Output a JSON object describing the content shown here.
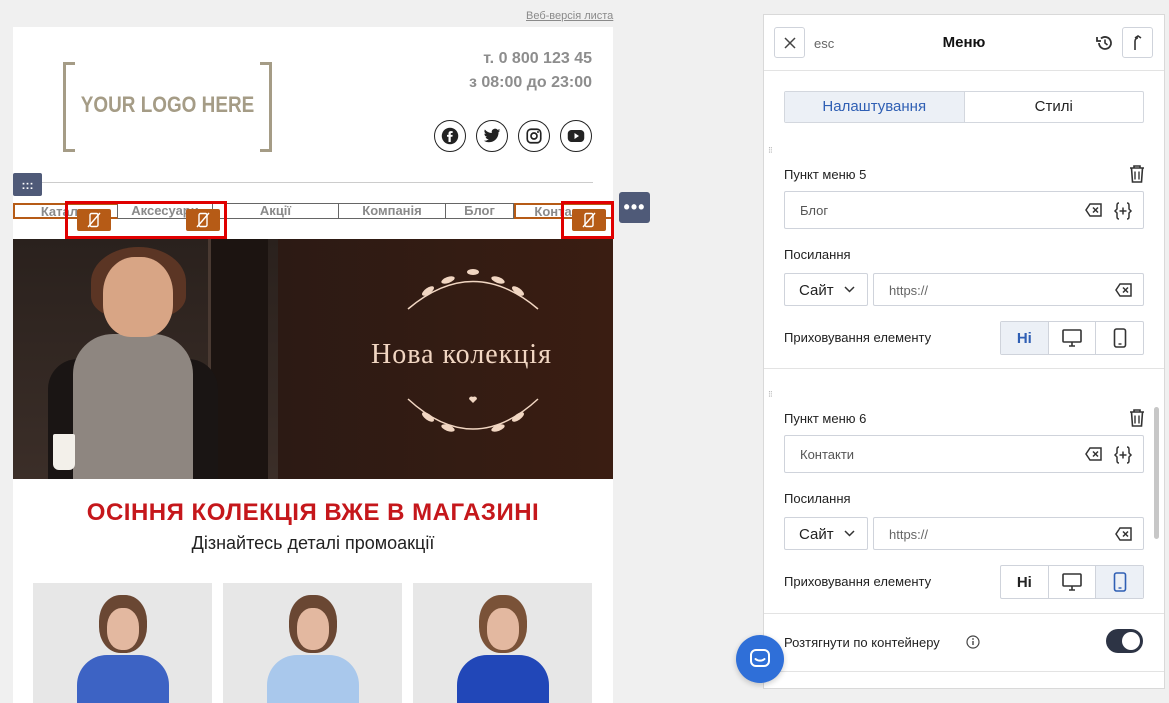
{
  "email": {
    "web_version_link": "Веб-версія листа",
    "logo_text": "YOUR LOGO HERE",
    "phone": "т. 0 800 123 45",
    "hours": "з 08:00 до 23:00",
    "socials": [
      "facebook-icon",
      "twitter-icon",
      "instagram-icon",
      "youtube-icon"
    ],
    "menu_items": [
      "Каталог",
      "Аксесуари",
      "Акції",
      "Компанія",
      "Блог",
      "Контакти"
    ],
    "hero_title": "Нова колекція",
    "headline": "ОСІННЯ КОЛЕКЦІЯ ВЖЕ В МАГАЗИНІ",
    "subheadline": "Дізнайтесь деталі промоакції",
    "colors": {
      "headline": "#c5171b",
      "accent": "#b65b16",
      "coat": "#3d63c4"
    }
  },
  "panel": {
    "close_hint": "esc",
    "title": "Меню",
    "tabs": [
      "Налаштування",
      "Стилі"
    ],
    "active_tab": "Налаштування",
    "items": [
      {
        "heading": "Пункт меню 5",
        "name_value": "Блог",
        "link_label": "Посилання",
        "link_type": "Сайт",
        "url_value": "https://",
        "hide_label": "Приховування елементу",
        "hide_options": [
          "Ні",
          "desktop-icon",
          "mobile-icon"
        ],
        "hide_selected": "Ні"
      },
      {
        "heading": "Пункт меню 6",
        "name_value": "Контакти",
        "link_label": "Посилання",
        "link_type": "Сайт",
        "url_value": "https://",
        "hide_label": "Приховування елементу",
        "hide_options": [
          "Ні",
          "desktop-icon",
          "mobile-icon"
        ],
        "hide_selected": "mobile"
      }
    ],
    "stretch_label": "Розтягнути по контейнеру",
    "stretch_on": true
  }
}
